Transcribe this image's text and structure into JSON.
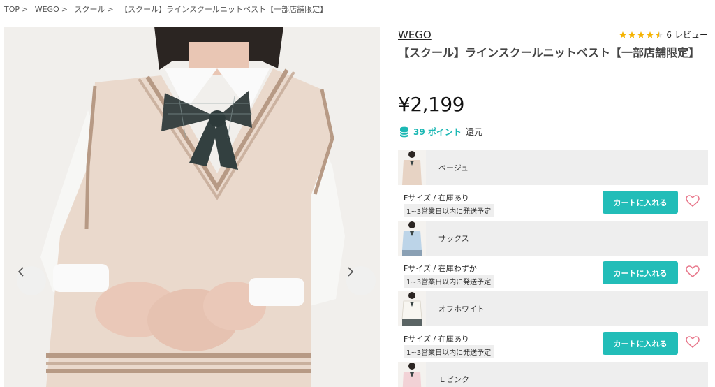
{
  "breadcrumb": [
    "TOP",
    "WEGO",
    "スクール",
    "【スクール】ラインスクールニットベスト【一部店舗限定】"
  ],
  "breadcrumb_sep": ">",
  "product": {
    "brand": "WEGO",
    "title": "【スクール】ラインスクールニットベスト【一部店舗限定】",
    "price": "¥2,199",
    "rating_value": 4.5,
    "review_count": "6",
    "review_label": "レビュー",
    "points_value": "39 ポイント",
    "points_suffix": "還元"
  },
  "variants": [
    {
      "color": "ベージュ",
      "stock": "Fサイズ / 在庫あり",
      "ship": "1~3営業日以内に発送予定",
      "cart": "カートに入れる",
      "swatch": "#e7d3c4"
    },
    {
      "color": "サックス",
      "stock": "Fサイズ / 在庫わずか",
      "ship": "1~3営業日以内に発送予定",
      "cart": "カートに入れる",
      "swatch": "#bcd4e8"
    },
    {
      "color": "オフホワイト",
      "stock": "Fサイズ / 在庫あり",
      "ship": "1~3営業日以内に発送予定",
      "cart": "カートに入れる",
      "swatch": "#f4f1ea"
    },
    {
      "color": "Ｌピンク",
      "swatch": "#f2d2d6"
    }
  ],
  "colors": {
    "accent": "#22bdb8",
    "star": "#f5b301",
    "heart": "#e8768a"
  }
}
